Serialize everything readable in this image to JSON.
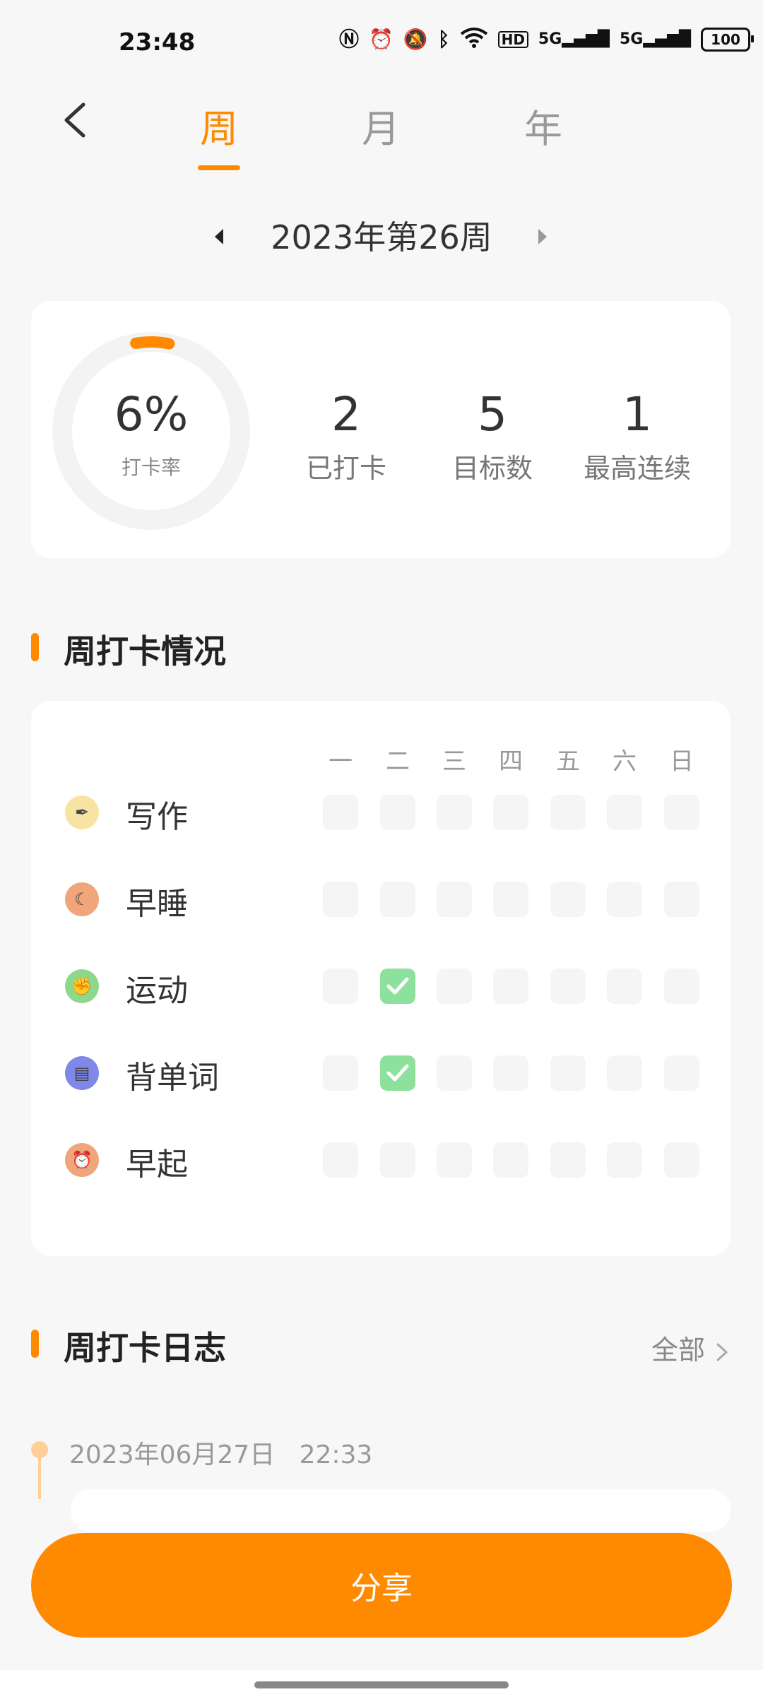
{
  "status": {
    "time": "23:48",
    "battery": "100",
    "signal_label": "5G"
  },
  "header": {
    "tabs": [
      {
        "label": "周",
        "active": true
      },
      {
        "label": "月",
        "active": false
      },
      {
        "label": "年",
        "active": false
      }
    ]
  },
  "period": {
    "label": "2023年第26周"
  },
  "summary": {
    "rate": "6%",
    "rate_fraction": 0.06,
    "rate_label": "打卡率",
    "stats": [
      {
        "value": "2",
        "label": "已打卡"
      },
      {
        "value": "5",
        "label": "目标数"
      },
      {
        "value": "1",
        "label": "最高连续"
      }
    ]
  },
  "weekly": {
    "title": "周打卡情况",
    "days": [
      "一",
      "二",
      "三",
      "四",
      "五",
      "六",
      "日"
    ],
    "habits": [
      {
        "name": "写作",
        "icon": "pen-icon",
        "color": "#f8e4a2",
        "checked": [
          false,
          false,
          false,
          false,
          false,
          false,
          false
        ]
      },
      {
        "name": "早睡",
        "icon": "moon-icon",
        "color": "#f0a57a",
        "checked": [
          false,
          false,
          false,
          false,
          false,
          false,
          false
        ]
      },
      {
        "name": "运动",
        "icon": "muscle-icon",
        "color": "#8ed88b",
        "checked": [
          false,
          true,
          false,
          false,
          false,
          false,
          false
        ]
      },
      {
        "name": "背单词",
        "icon": "book-icon",
        "color": "#7f87e8",
        "checked": [
          false,
          true,
          false,
          false,
          false,
          false,
          false
        ]
      },
      {
        "name": "早起",
        "icon": "alarm-clock-icon",
        "color": "#f0a57a",
        "checked": [
          false,
          false,
          false,
          false,
          false,
          false,
          false
        ]
      }
    ]
  },
  "journal": {
    "title": "周打卡日志",
    "more_label": "全部",
    "entries": [
      {
        "date": "2023年06月27日",
        "time": "22:33"
      }
    ]
  },
  "share": {
    "label": "分享"
  },
  "colors": {
    "accent": "#ff8a00",
    "check": "#8ee09d"
  }
}
